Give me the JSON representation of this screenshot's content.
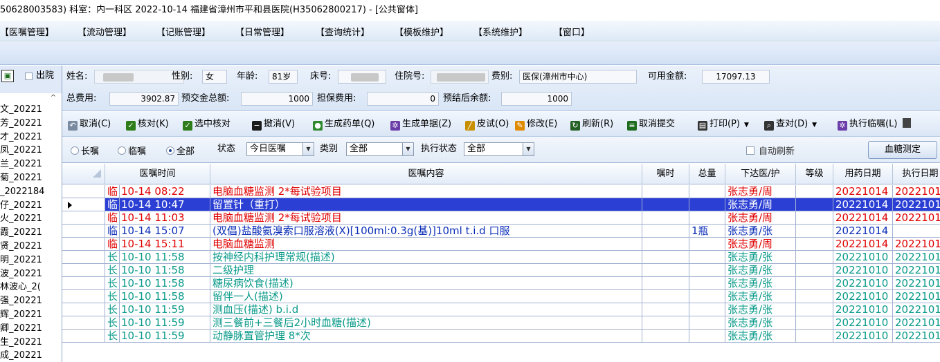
{
  "window": {
    "title": "50628003583) 科室：内一科区  2022-10-14  福建省漳州市平和县医院(H35062800217) - [公共窗体]"
  },
  "menu": [
    "【医嘱管理】",
    "【流动管理】",
    "【记账管理】",
    "【日常管理】",
    "【查询统计】",
    "【模板维护】",
    "【系统维护】",
    "【窗口】"
  ],
  "left_panel": {
    "discharge_label": "出院",
    "patients": [
      "文_20221",
      "芳_20221",
      "才_20221",
      "凤_20221",
      "兰_20221",
      "菊_20221",
      "_2022184",
      "仔_20221",
      "火_20221",
      "霞_20221",
      "贤_20221",
      "明_20221",
      "波_20221",
      "林波心_2(",
      "强_20221",
      "辉_20221",
      "卿_20221",
      "生_20221",
      "成_20221"
    ]
  },
  "patient_info": {
    "name_label": "姓名:",
    "sex_label": "性别:",
    "sex_value": "女",
    "age_label": "年龄:",
    "age_value": "81岁",
    "bed_label": "床号:",
    "inpatient_no_label": "住院号:",
    "fee_type_label": "费别:",
    "fee_type_value": "医保(漳州市中心)",
    "available_label": "可用金额:",
    "available_value": "17097.13",
    "total_fee_label": "总费用:",
    "total_fee_value": "3902.87",
    "prepay_label": "预交金总额:",
    "prepay_value": "1000",
    "guarantee_label": "担保费用:",
    "guarantee_value": "0",
    "balance_label": "预结后余额:",
    "balance_value": "1000"
  },
  "toolbar": [
    {
      "icon": "undo-icon",
      "label": "取消(C)",
      "color": "#7a8aa0"
    },
    {
      "icon": "check-icon",
      "label": "核对(K)",
      "color": "#2f7d1a"
    },
    {
      "icon": "check-icon",
      "label": "选中核对",
      "color": "#2f7d1a"
    },
    {
      "icon": "minus-circle-icon",
      "label": "撤消(V)",
      "color": "#1a1a1a"
    },
    {
      "icon": "medicine-icon",
      "label": "生成药单(Q)",
      "color": "#2d8a2d"
    },
    {
      "icon": "gear-icon",
      "label": "生成单据(Z)",
      "color": "#6a3da8"
    },
    {
      "icon": "syringe-icon",
      "label": "皮试(O)",
      "color": "#c89000"
    },
    {
      "icon": "edit-icon",
      "label": "修改(E)",
      "color": "#e08a00"
    },
    {
      "icon": "refresh-icon",
      "label": "刷新(R)",
      "color": "#245f24"
    },
    {
      "icon": "cancel-submit-icon",
      "label": "取消提交",
      "color": "#1d6b1d"
    },
    {
      "icon": "print-icon",
      "label": "打印(P)",
      "color": "#333333"
    },
    {
      "icon": "search-icon",
      "label": "查对(D)",
      "color": "#333333"
    },
    {
      "icon": "gear-icon",
      "label": "执行临嘱(L)",
      "color": "#6a3da8"
    }
  ],
  "filter": {
    "long_term": "长嘱",
    "temporary": "临嘱",
    "all": "全部",
    "status_label": "状态",
    "status_value": "今日医嘱",
    "category_label": "类别",
    "category_value": "全部",
    "exec_status_label": "执行状态",
    "exec_status_value": "全部",
    "auto_refresh": "自动刷新",
    "glucose_button": "血糖测定"
  },
  "grid": {
    "columns": [
      "医嘱时间",
      "医嘱内容",
      "嘱时",
      "总量",
      "下达医/护",
      "等级",
      "用药日期",
      "执行日期"
    ],
    "rows": [
      {
        "type": "临",
        "time": "10-14 08:22",
        "content": "电脑血糖监测  2*每试验项目",
        "dose_time": "",
        "total": "",
        "doctor": "张志勇/周",
        "level": "",
        "drug_date": "20221014",
        "exec_date": "2022101",
        "color": "red",
        "selected": false
      },
      {
        "type": "临",
        "time": "10-14 10:47",
        "content": "留置针（重打）",
        "dose_time": "",
        "total": "",
        "doctor": "张志勇/周",
        "level": "",
        "drug_date": "20221014",
        "exec_date": "2022101",
        "color": "red",
        "selected": true
      },
      {
        "type": "临",
        "time": "10-14 11:03",
        "content": "电脑血糖监测  2*每试验项目",
        "dose_time": "",
        "total": "",
        "doctor": "张志勇/周",
        "level": "",
        "drug_date": "20221014",
        "exec_date": "2022101",
        "color": "red",
        "selected": false
      },
      {
        "type": "临",
        "time": "10-14 15:07",
        "content": "(双倡)盐酸氨溴索口服溶液(X)[100ml:0.3g(基)]10ml  t.i.d 口服",
        "dose_time": "",
        "total": "1瓶",
        "doctor": "张志勇/张",
        "level": "",
        "drug_date": "20221014",
        "exec_date": "",
        "color": "blue",
        "selected": false
      },
      {
        "type": "临",
        "time": "10-14 15:11",
        "content": "电脑血糖监测",
        "dose_time": "",
        "total": "",
        "doctor": "张志勇/周",
        "level": "",
        "drug_date": "20221014",
        "exec_date": "2022101",
        "color": "red",
        "selected": false
      },
      {
        "type": "长",
        "time": "10-10 11:58",
        "content": "按神经内科护理常规(描述)",
        "dose_time": "",
        "total": "",
        "doctor": "张志勇/张",
        "level": "",
        "drug_date": "20221010",
        "exec_date": "2022101",
        "color": "green",
        "selected": false
      },
      {
        "type": "长",
        "time": "10-10 11:58",
        "content": "二级护理",
        "dose_time": "",
        "total": "",
        "doctor": "张志勇/张",
        "level": "",
        "drug_date": "20221010",
        "exec_date": "2022101",
        "color": "green",
        "selected": false
      },
      {
        "type": "长",
        "time": "10-10 11:58",
        "content": "糖尿病饮食(描述)",
        "dose_time": "",
        "total": "",
        "doctor": "张志勇/张",
        "level": "",
        "drug_date": "20221010",
        "exec_date": "2022101",
        "color": "green",
        "selected": false
      },
      {
        "type": "长",
        "time": "10-10 11:58",
        "content": "留伴一人(描述)",
        "dose_time": "",
        "total": "",
        "doctor": "张志勇/张",
        "level": "",
        "drug_date": "20221010",
        "exec_date": "2022101",
        "color": "green",
        "selected": false
      },
      {
        "type": "长",
        "time": "10-10 11:59",
        "content": "测血压(描述) b.i.d",
        "dose_time": "",
        "total": "",
        "doctor": "张志勇/张",
        "level": "",
        "drug_date": "20221010",
        "exec_date": "2022101",
        "color": "green",
        "selected": false
      },
      {
        "type": "长",
        "time": "10-10 11:59",
        "content": "测三餐前+三餐后2小时血糖(描述)",
        "dose_time": "",
        "total": "",
        "doctor": "张志勇/张",
        "level": "",
        "drug_date": "20221010",
        "exec_date": "2022101",
        "color": "green",
        "selected": false
      },
      {
        "type": "长",
        "time": "10-10 11:59",
        "content": "动静脉置管护理  8*次",
        "dose_time": "",
        "total": "",
        "doctor": "张志勇/张",
        "level": "",
        "drug_date": "20221010",
        "exec_date": "2022101",
        "color": "green",
        "selected": false
      }
    ]
  }
}
